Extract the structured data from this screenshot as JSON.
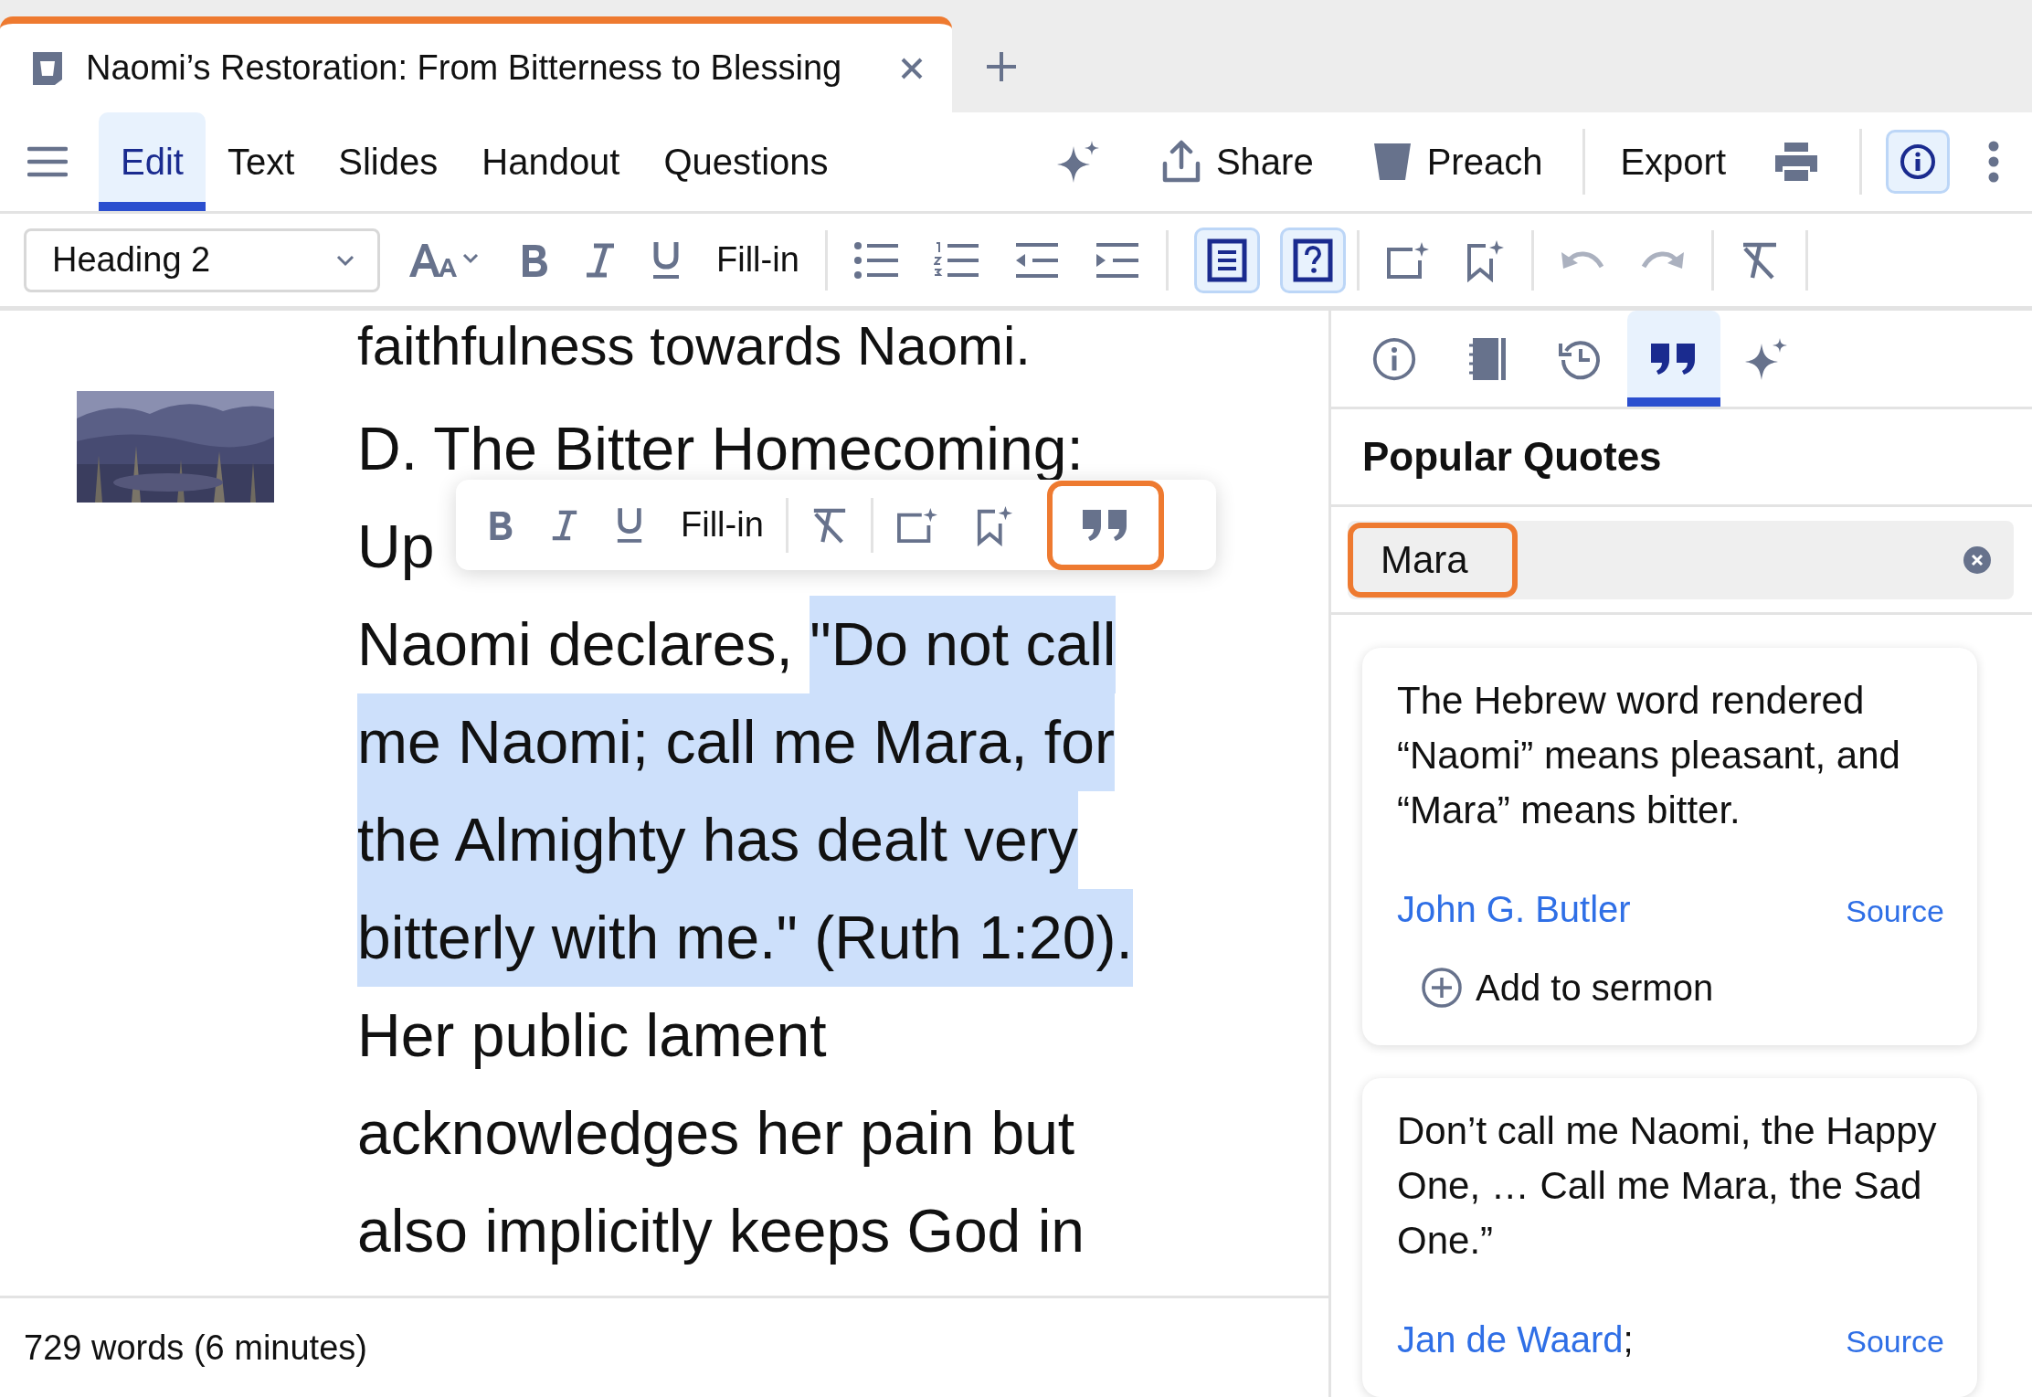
{
  "tab": {
    "title": "Naomi’s Restoration: From Bitterness to Blessing"
  },
  "menu": {
    "items": [
      {
        "label": "Edit",
        "selected": true
      },
      {
        "label": "Text",
        "selected": false
      },
      {
        "label": "Slides",
        "selected": false
      },
      {
        "label": "Handout",
        "selected": false
      },
      {
        "label": "Questions",
        "selected": false
      }
    ],
    "actions": [
      {
        "kind": "share",
        "label": "Share"
      },
      {
        "kind": "preach",
        "label": "Preach"
      },
      {
        "kind": "export",
        "label": "Export"
      }
    ],
    "info_selected": true
  },
  "toolbar": {
    "style": "Heading 2",
    "fill_in": "Fill-in",
    "toggles": [
      {
        "kind": "outline",
        "selected": true
      },
      {
        "kind": "question",
        "selected": true
      }
    ],
    "history": [
      {
        "kind": "undo",
        "disabled": true
      },
      {
        "kind": "redo",
        "disabled": true
      }
    ]
  },
  "editor": {
    "previous_line": "faithfulness towards Naomi.",
    "lines": [
      {
        "segments": [
          {
            "text": "D. The Bitter Homecoming:",
            "selected": false
          }
        ]
      },
      {
        "segments": [
          {
            "text": "Up",
            "selected": false
          }
        ]
      },
      {
        "segments": [
          {
            "text": "Naomi declares, ",
            "selected": false
          },
          {
            "text": "\"Do not call",
            "selected": true
          }
        ]
      },
      {
        "segments": [
          {
            "text": "me Naomi; call me Mara, for",
            "selected": true
          }
        ]
      },
      {
        "segments": [
          {
            "text": "the Almighty has dealt very",
            "selected": true
          }
        ]
      },
      {
        "segments": [
          {
            "text": "bitterly with me.\" (Ruth 1:20).",
            "selected": true
          }
        ]
      },
      {
        "segments": [
          {
            "text": "Her public lament",
            "selected": false
          }
        ]
      },
      {
        "segments": [
          {
            "text": "acknowledges her pain but",
            "selected": false
          }
        ]
      },
      {
        "segments": [
          {
            "text": "also implicitly keeps God in",
            "selected": false
          }
        ]
      }
    ],
    "float_toolbar": {
      "fill_in": "Fill-in",
      "quote_highlighted": true
    }
  },
  "status_bar": {
    "words": "729 words (6 minutes)"
  },
  "side_panel": {
    "tabs": [
      {
        "kind": "info",
        "selected": false
      },
      {
        "kind": "book",
        "selected": false
      },
      {
        "kind": "history",
        "selected": false
      },
      {
        "kind": "quotes",
        "selected": true
      },
      {
        "kind": "sparkle",
        "selected": false
      }
    ],
    "title": "Popular Quotes",
    "search": {
      "value": "Mara",
      "highlighted": true
    },
    "quotes": [
      {
        "text": "The Hebrew word rendered “Naomi” means pleasant, and “Mara” means bitter.",
        "author": "John G. Butler",
        "source": "Source",
        "add": "Add to sermon"
      },
      {
        "text": "Don’t call me Naomi, the Happy One, … Call me Mara, the Sad One.”",
        "author": "Jan de Waard",
        "suffix": ";",
        "source": "Source"
      }
    ]
  }
}
